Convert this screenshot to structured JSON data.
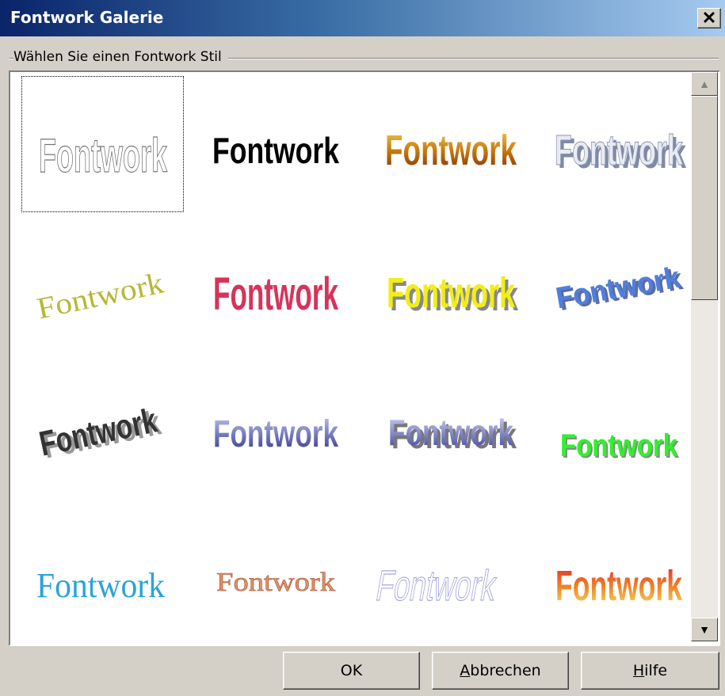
{
  "window": {
    "title": "Fontwork Galerie",
    "close_label": "✕"
  },
  "group": {
    "label": "Wählen Sie einen Fontwork Stil"
  },
  "gallery": {
    "item_text": "Fontwork",
    "selected_index": 0,
    "items": [
      {
        "style": "outline-gray"
      },
      {
        "style": "black-wave"
      },
      {
        "style": "gold-gradient"
      },
      {
        "style": "silver-3d"
      },
      {
        "style": "olive-serif-slant"
      },
      {
        "style": "red-perspective"
      },
      {
        "style": "yellow-3d"
      },
      {
        "style": "blue-3d-rising"
      },
      {
        "style": "gray-3d-tilt"
      },
      {
        "style": "blue-purple-wave"
      },
      {
        "style": "blue-3d-wave"
      },
      {
        "style": "green-arch"
      },
      {
        "style": "cyan-slant"
      },
      {
        "style": "orange-arc"
      },
      {
        "style": "lavender-outline"
      },
      {
        "style": "red-yellow-gradient"
      }
    ]
  },
  "buttons": {
    "ok": "OK",
    "cancel_prefix": "A",
    "cancel_rest": "bbrechen",
    "help_prefix": "H",
    "help_rest": "ilfe"
  },
  "scrollbar": {
    "up_glyph": "▲",
    "down_glyph": "▼"
  }
}
